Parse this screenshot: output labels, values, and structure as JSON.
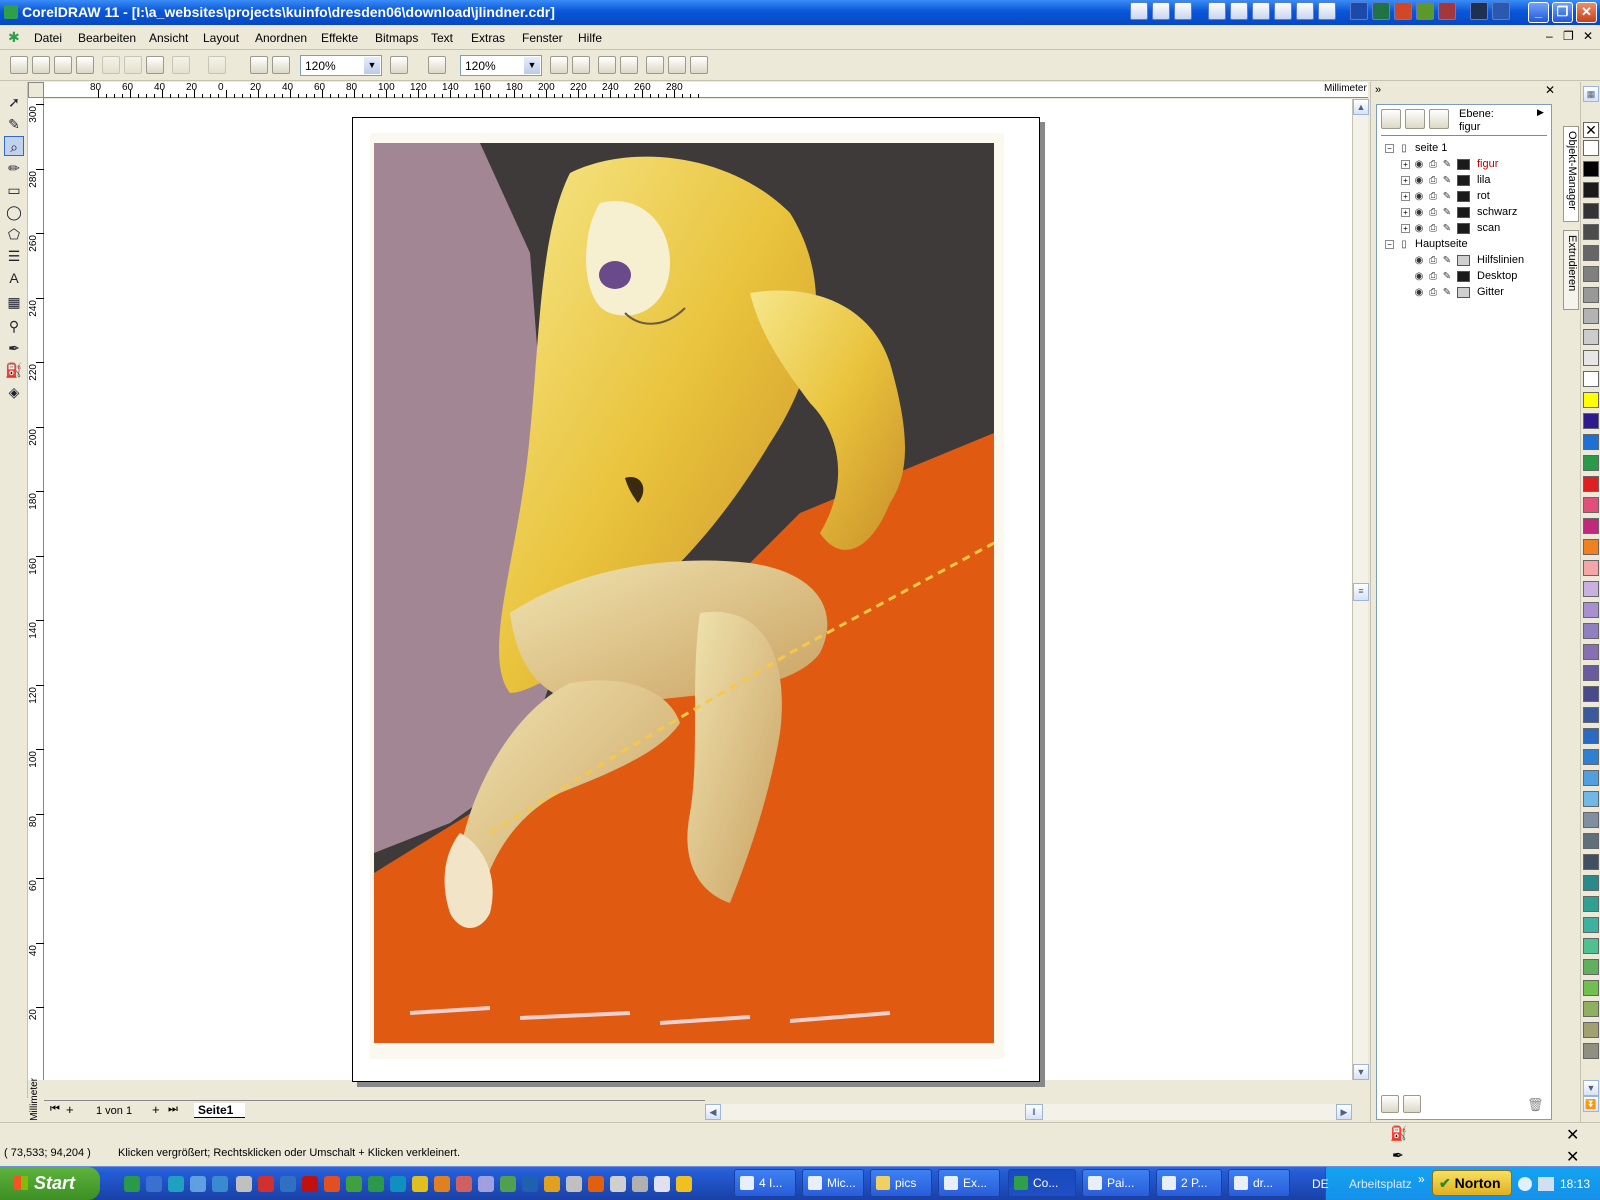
{
  "window": {
    "title": "CorelDRAW 11 - [I:\\a_websites\\projects\\kuinfo\\dresden06\\download\\jlindner.cdr]",
    "minimize": "_",
    "maximize": "❐",
    "close": "✕"
  },
  "menu": [
    {
      "label": "Datei",
      "key": "D"
    },
    {
      "label": "Bearbeiten",
      "key": "B"
    },
    {
      "label": "Ansicht",
      "key": "A"
    },
    {
      "label": "Layout",
      "key": "L"
    },
    {
      "label": "Anordnen",
      "key": "A"
    },
    {
      "label": "Effekte",
      "key": "E"
    },
    {
      "label": "Bitmaps",
      "key": "B"
    },
    {
      "label": "Text",
      "key": "T"
    },
    {
      "label": "Extras",
      "key": "E"
    },
    {
      "label": "Fenster",
      "key": "F"
    },
    {
      "label": "Hilfe",
      "key": "H"
    }
  ],
  "toolbar": {
    "zoom1": "120%",
    "zoom2": "120%"
  },
  "ruler": {
    "unit_h": "Millimeter",
    "unit_v": "Millimeter",
    "h_ticks": [
      "80",
      "60",
      "40",
      "20",
      "0",
      "20",
      "40",
      "60",
      "80",
      "100",
      "120",
      "140",
      "160",
      "180",
      "200",
      "220",
      "240",
      "260",
      "280"
    ],
    "v_ticks": [
      "300",
      "280",
      "260",
      "240",
      "220",
      "200",
      "180",
      "160",
      "140",
      "120",
      "100",
      "80",
      "60",
      "40",
      "20"
    ]
  },
  "pagenav": {
    "count": "1 von 1",
    "tab": "Seite1"
  },
  "object_manager": {
    "layer_label": "Ebene:",
    "layer_value": "figur",
    "tree": [
      {
        "label": "seite 1",
        "level": 0,
        "type": "page"
      },
      {
        "label": "figur",
        "level": 1,
        "type": "layer",
        "color": "#1a1a1a",
        "active": true
      },
      {
        "label": "lila",
        "level": 1,
        "type": "layer",
        "color": "#1a1a1a"
      },
      {
        "label": "rot",
        "level": 1,
        "type": "layer",
        "color": "#1a1a1a"
      },
      {
        "label": "schwarz",
        "level": 1,
        "type": "layer",
        "color": "#1a1a1a"
      },
      {
        "label": "scan",
        "level": 1,
        "type": "layer",
        "color": "#1a1a1a"
      },
      {
        "label": "Hauptseite",
        "level": 0,
        "type": "page"
      },
      {
        "label": "Hilfslinien",
        "level": 2,
        "type": "layer",
        "color": "#cfcfcf"
      },
      {
        "label": "Desktop",
        "level": 2,
        "type": "layer",
        "color": "#1a1a1a"
      },
      {
        "label": "Gitter",
        "level": 2,
        "type": "layer",
        "color": "#cfcfcf"
      }
    ],
    "tabs": [
      "Objekt-Manager",
      "Extrudieren"
    ]
  },
  "palette": [
    "#ffffff",
    "#000000",
    "#1a1a1a",
    "#333333",
    "#4d4d4d",
    "#666666",
    "#808080",
    "#999999",
    "#b3b3b3",
    "#cccccc",
    "#e6e6e6",
    "#ffffff",
    "#ffff00",
    "#2e1a8a",
    "#1f6fd6",
    "#2a9a4a",
    "#e02020",
    "#e0507a",
    "#c0287a",
    "#f08020",
    "#f4a6a6",
    "#c8b0e0",
    "#a890d0",
    "#9080c0",
    "#8870b0",
    "#6a5aa0",
    "#4a4a8a",
    "#3a5a9a",
    "#2a6ac0",
    "#3080d0",
    "#50a0e0",
    "#70b8e8",
    "#8090a0",
    "#60707a",
    "#405060",
    "#2a8a8a",
    "#30a090",
    "#40b0a0",
    "#50c090",
    "#60b060",
    "#70c050",
    "#90b060",
    "#a0a070",
    "#909080"
  ],
  "status": {
    "coords": "( 73,533; 94,204 )",
    "message": "Klicken vergrößert; Rechtsklicken oder Umschalt + Klicken verkleinert."
  },
  "taskbar": {
    "start": "Start",
    "tasks": [
      "4 I...",
      "Mic...",
      "pics",
      "Ex...",
      "Co...",
      "Pai...",
      "2 P...",
      "dr..."
    ],
    "lang": "DE",
    "arbeitsplatz": "Arbeitsplatz",
    "norton": "Norton",
    "clock": "18:13"
  }
}
